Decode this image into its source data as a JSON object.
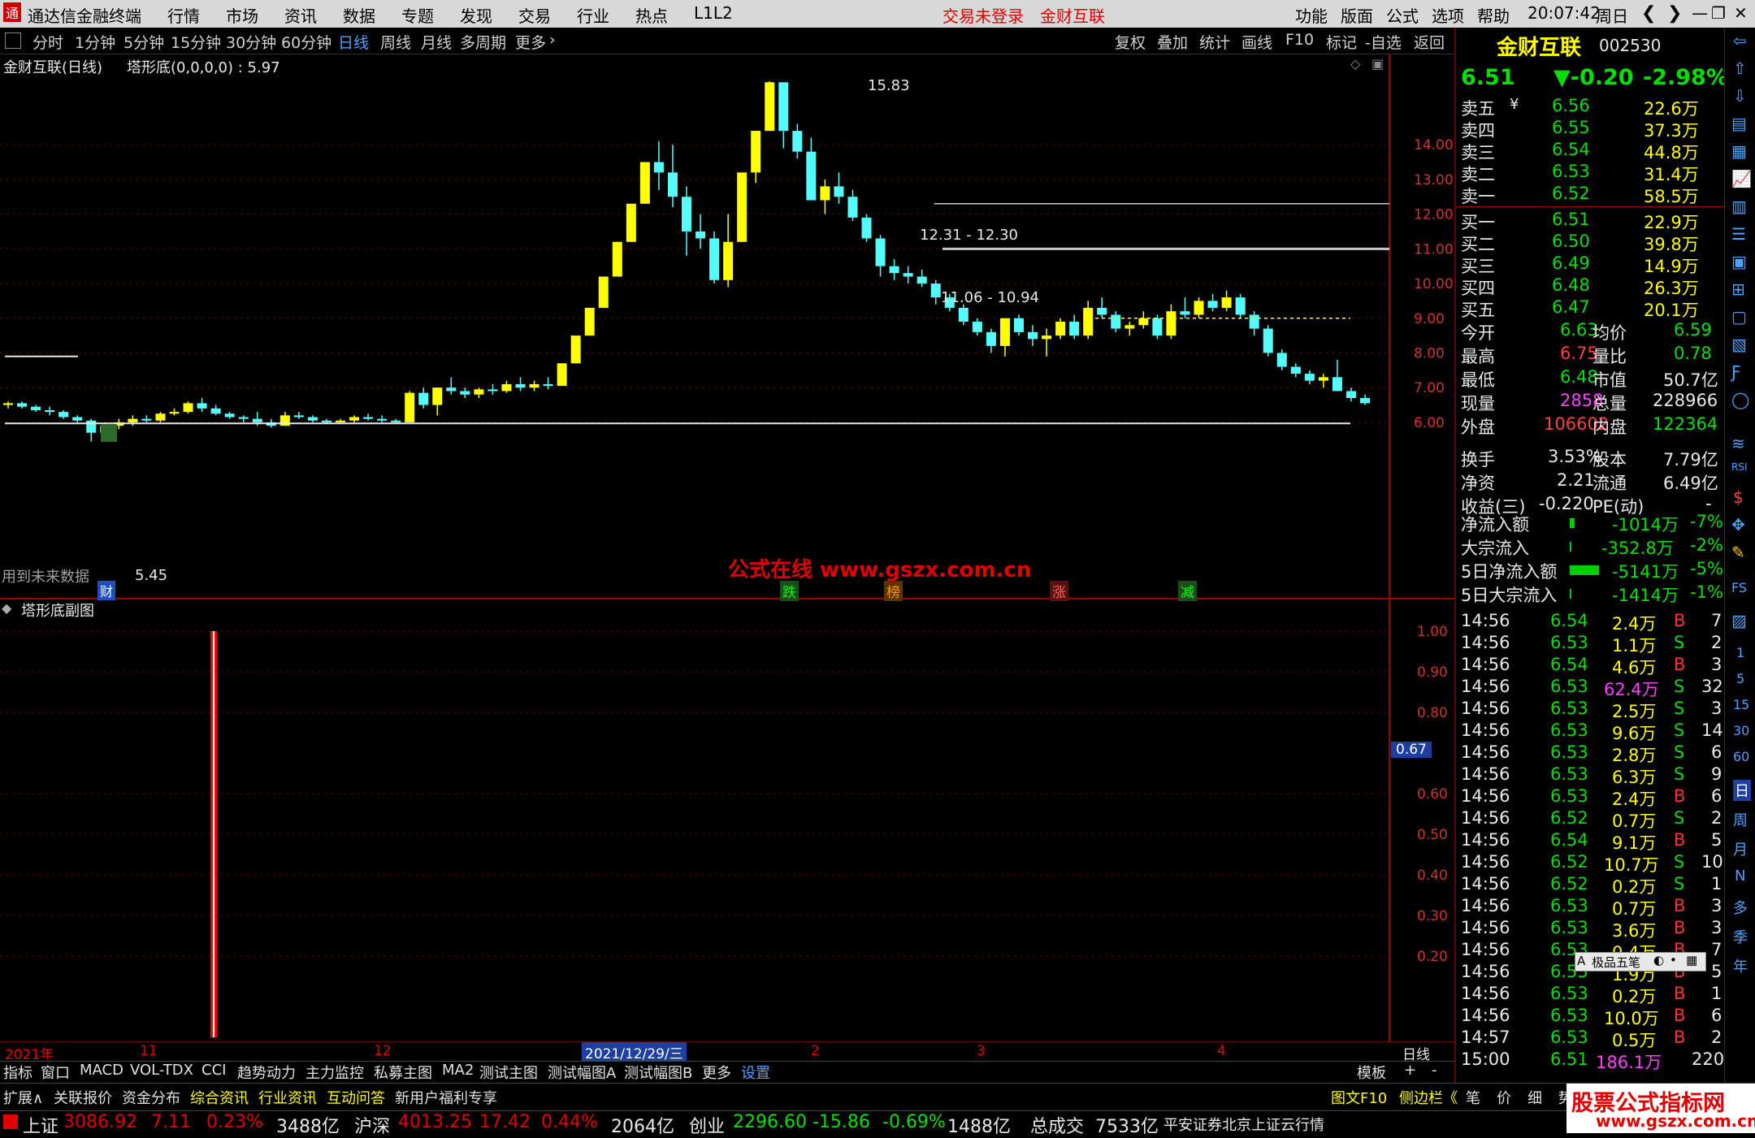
{
  "app": {
    "title": "通达信金融终端",
    "menu": [
      "行情",
      "市场",
      "资讯",
      "数据",
      "专题",
      "发现",
      "交易",
      "行业",
      "热点",
      "L1L2"
    ],
    "login_status": "交易未登录",
    "stock_label": "金财互联",
    "right_menu": [
      "功能",
      "版面",
      "公式",
      "选项",
      "帮助"
    ],
    "clock": "20:07:42",
    "weekday": "周日"
  },
  "periods": [
    "分时",
    "1分钟",
    "5分钟",
    "15分钟",
    "30分钟",
    "60分钟",
    "日线",
    "周线",
    "月线",
    "多周期",
    "更多"
  ],
  "active_period": "日线",
  "tools": [
    "复权",
    "叠加",
    "统计",
    "画线",
    "F10",
    "标记",
    "-自选",
    "返回"
  ],
  "chart": {
    "header_name": "金财互联(日线)",
    "indicator": "塔形底(0,0,0,0) : 5.97",
    "sub_header": "塔形底副图",
    "watermark": "公式在线  www.gszx.com.cn",
    "future_note": "用到未来数据",
    "cai_marker": "财",
    "markers": [
      "跌",
      "榜",
      "涨",
      "减"
    ],
    "annotations": {
      "high": "15.83",
      "low": "5.45",
      "level1": "12.31 - 12.30",
      "level2": "11.06 - 10.94"
    },
    "price_axis": [
      "14.00",
      "13.00",
      "12.00",
      "11.00",
      "10.00",
      "9.00",
      "8.00",
      "7.00",
      "6.00"
    ],
    "sub_axis": [
      "1.00",
      "0.90",
      "0.80",
      "0.60",
      "0.50",
      "0.40",
      "0.30",
      "0.20"
    ],
    "sub_current": "0.67",
    "date_labels": [
      "2021年",
      "11",
      "12",
      "2021/12/29/三",
      "2",
      "3",
      "4"
    ],
    "period_label": "日线",
    "colors": {
      "up": "#ffff00",
      "down": "#54fcfc",
      "grid": "#800000",
      "signal": "#ff0000"
    }
  },
  "chart_data": {
    "type": "candlestick",
    "title": "",
    "y_axis_range": [
      5.45,
      15.83
    ],
    "series": [
      {
        "values": [
          [
            6.5,
            6.6,
            6.4,
            6.55
          ],
          [
            6.55,
            6.6,
            6.4,
            6.45
          ],
          [
            6.45,
            6.5,
            6.3,
            6.35
          ],
          [
            6.35,
            6.45,
            6.2,
            6.3
          ],
          [
            6.3,
            6.35,
            6.1,
            6.15
          ],
          [
            6.15,
            6.2,
            6.0,
            6.05
          ],
          [
            6.05,
            6.1,
            5.45,
            5.7
          ],
          [
            5.7,
            6.0,
            5.6,
            5.9
          ],
          [
            5.9,
            6.1,
            5.8,
            6.0
          ],
          [
            6.0,
            6.2,
            5.9,
            6.1
          ],
          [
            6.1,
            6.2,
            6.0,
            6.05
          ],
          [
            6.05,
            6.3,
            6.0,
            6.25
          ],
          [
            6.25,
            6.4,
            6.2,
            6.3
          ],
          [
            6.3,
            6.6,
            6.25,
            6.55
          ],
          [
            6.55,
            6.7,
            6.3,
            6.4
          ],
          [
            6.4,
            6.5,
            6.2,
            6.25
          ],
          [
            6.25,
            6.3,
            6.1,
            6.15
          ],
          [
            6.15,
            6.2,
            6.0,
            6.1
          ],
          [
            6.1,
            6.3,
            5.9,
            6.0
          ],
          [
            6.0,
            6.1,
            5.85,
            5.9
          ],
          [
            5.9,
            6.3,
            5.9,
            6.2
          ],
          [
            6.2,
            6.3,
            6.1,
            6.15
          ],
          [
            6.15,
            6.2,
            6.0,
            6.05
          ],
          [
            6.05,
            6.1,
            5.95,
            6.0
          ],
          [
            6.0,
            6.1,
            5.95,
            6.05
          ],
          [
            6.05,
            6.2,
            6.0,
            6.15
          ],
          [
            6.15,
            6.25,
            6.05,
            6.1
          ],
          [
            6.1,
            6.2,
            6.0,
            6.05
          ],
          [
            6.05,
            6.1,
            5.95,
            6.0
          ],
          [
            6.0,
            6.9,
            6.0,
            6.85
          ],
          [
            6.85,
            7.0,
            6.4,
            6.5
          ],
          [
            6.5,
            7.0,
            6.2,
            7.0
          ],
          [
            7.0,
            7.3,
            6.8,
            6.9
          ],
          [
            6.9,
            7.0,
            6.7,
            6.8
          ],
          [
            6.8,
            7.0,
            6.7,
            6.95
          ],
          [
            6.95,
            7.1,
            6.8,
            6.9
          ],
          [
            6.9,
            7.2,
            6.85,
            7.1
          ],
          [
            7.1,
            7.3,
            6.9,
            7.0
          ],
          [
            7.0,
            7.2,
            6.9,
            7.1
          ],
          [
            7.1,
            7.3,
            6.95,
            7.05
          ],
          [
            7.05,
            7.7,
            7.05,
            7.7
          ],
          [
            7.7,
            8.5,
            7.7,
            8.5
          ],
          [
            8.5,
            9.3,
            8.5,
            9.3
          ],
          [
            9.3,
            10.2,
            9.3,
            10.2
          ],
          [
            10.2,
            11.2,
            10.2,
            11.2
          ],
          [
            11.2,
            12.3,
            11.2,
            12.3
          ],
          [
            12.3,
            13.5,
            12.3,
            13.5
          ],
          [
            13.5,
            14.1,
            12.7,
            13.2
          ],
          [
            13.2,
            14.0,
            12.2,
            12.5
          ],
          [
            12.5,
            12.8,
            10.8,
            11.5
          ],
          [
            11.5,
            12.0,
            11.0,
            11.3
          ],
          [
            11.3,
            11.5,
            10.0,
            10.1
          ],
          [
            10.1,
            12.0,
            9.9,
            11.2
          ],
          [
            11.2,
            13.2,
            11.2,
            13.2
          ],
          [
            13.2,
            14.4,
            12.9,
            14.4
          ],
          [
            14.4,
            15.83,
            14.4,
            15.8
          ],
          [
            15.8,
            15.0,
            13.9,
            14.4
          ],
          [
            14.4,
            14.6,
            13.6,
            13.8
          ],
          [
            13.8,
            14.2,
            12.4,
            12.4
          ],
          [
            12.4,
            13.0,
            12.0,
            12.8
          ],
          [
            12.8,
            13.2,
            12.3,
            12.5
          ],
          [
            12.5,
            12.7,
            11.8,
            11.9
          ],
          [
            11.9,
            12.0,
            11.2,
            11.3
          ],
          [
            11.3,
            11.4,
            10.2,
            10.5
          ],
          [
            10.5,
            10.7,
            10.1,
            10.3
          ],
          [
            10.3,
            10.5,
            10.0,
            10.2
          ],
          [
            10.2,
            10.4,
            9.9,
            10.0
          ],
          [
            10.0,
            10.1,
            9.4,
            9.6
          ],
          [
            9.6,
            9.7,
            9.2,
            9.3
          ],
          [
            9.3,
            9.4,
            8.8,
            8.9
          ],
          [
            8.9,
            9.0,
            8.5,
            8.6
          ],
          [
            8.6,
            8.7,
            8.0,
            8.2
          ],
          [
            8.2,
            9.0,
            7.9,
            9.0
          ],
          [
            9.0,
            9.1,
            8.5,
            8.6
          ],
          [
            8.6,
            8.8,
            8.2,
            8.4
          ],
          [
            8.4,
            8.7,
            7.9,
            8.5
          ],
          [
            8.5,
            9.0,
            8.4,
            8.9
          ],
          [
            8.9,
            9.1,
            8.4,
            8.5
          ],
          [
            8.5,
            9.5,
            8.4,
            9.3
          ],
          [
            9.3,
            9.6,
            9.0,
            9.1
          ],
          [
            9.1,
            9.2,
            8.6,
            8.7
          ],
          [
            8.7,
            8.9,
            8.5,
            8.8
          ],
          [
            8.8,
            9.2,
            8.7,
            9.0
          ],
          [
            9.0,
            9.1,
            8.4,
            8.5
          ],
          [
            8.5,
            9.4,
            8.4,
            9.2
          ],
          [
            9.2,
            9.6,
            9.0,
            9.1
          ],
          [
            9.1,
            9.6,
            9.0,
            9.5
          ],
          [
            9.5,
            9.7,
            9.2,
            9.3
          ],
          [
            9.3,
            9.8,
            9.2,
            9.6
          ],
          [
            9.6,
            9.7,
            9.0,
            9.1
          ],
          [
            9.1,
            9.2,
            8.5,
            8.7
          ],
          [
            8.7,
            8.8,
            7.9,
            8.0
          ],
          [
            8.0,
            8.1,
            7.5,
            7.6
          ],
          [
            7.6,
            7.7,
            7.3,
            7.4
          ],
          [
            7.4,
            7.5,
            7.1,
            7.2
          ],
          [
            7.2,
            7.4,
            7.0,
            7.3
          ],
          [
            7.3,
            7.8,
            7.2,
            6.9
          ],
          [
            6.9,
            7.0,
            6.6,
            6.7
          ],
          [
            6.7,
            6.8,
            6.5,
            6.55
          ]
        ]
      }
    ]
  },
  "quote": {
    "name": "金财互联",
    "code": "002530",
    "price": "6.51",
    "change": "▼-0.20",
    "pct": "-2.98%",
    "asks": [
      {
        "label": "卖五",
        "price": "6.56",
        "vol": "22.6万"
      },
      {
        "label": "卖四",
        "price": "6.55",
        "vol": "37.3万"
      },
      {
        "label": "卖三",
        "price": "6.54",
        "vol": "44.8万"
      },
      {
        "label": "卖二",
        "price": "6.53",
        "vol": "31.4万"
      },
      {
        "label": "卖一",
        "price": "6.52",
        "vol": "58.5万"
      }
    ],
    "bids": [
      {
        "label": "买一",
        "price": "6.51",
        "vol": "22.9万"
      },
      {
        "label": "买二",
        "price": "6.50",
        "vol": "39.8万"
      },
      {
        "label": "买三",
        "price": "6.49",
        "vol": "14.9万"
      },
      {
        "label": "买四",
        "price": "6.48",
        "vol": "26.3万"
      },
      {
        "label": "买五",
        "price": "6.47",
        "vol": "20.1万"
      }
    ],
    "ask_currency": "¥",
    "stats": [
      [
        "今开",
        "6.63",
        "均价",
        "6.59"
      ],
      [
        "最高",
        "6.75",
        "量比",
        "0.78"
      ],
      [
        "最低",
        "6.48",
        "市值",
        "50.7亿"
      ],
      [
        "现量",
        "2858",
        "总量",
        "228966"
      ],
      [
        "外盘",
        "106602",
        "内盘",
        "122364"
      ]
    ],
    "stats2": [
      [
        "换手",
        "3.53%",
        "股本",
        "7.79亿"
      ],
      [
        "净资",
        "2.21",
        "流通",
        "6.49亿"
      ],
      [
        "收益(三)",
        "-0.220",
        "PE(动)",
        "-"
      ]
    ],
    "flows": [
      [
        "净流入额",
        "-1014万",
        "-7%"
      ],
      [
        "大宗流入",
        "-352.8万",
        "-2%"
      ],
      [
        "5日净流入额",
        "-5141万",
        "-5%"
      ],
      [
        "5日大宗流入",
        "-1414万",
        "-1%"
      ]
    ],
    "ticks": [
      [
        "14:56",
        "6.54",
        "2.4万",
        "B",
        "7"
      ],
      [
        "14:56",
        "6.53",
        "1.1万",
        "S",
        "2"
      ],
      [
        "14:56",
        "6.54",
        "4.6万",
        "B",
        "3"
      ],
      [
        "14:56",
        "6.53",
        "62.4万",
        "S",
        "32"
      ],
      [
        "14:56",
        "6.53",
        "2.5万",
        "S",
        "3"
      ],
      [
        "14:56",
        "6.53",
        "9.6万",
        "S",
        "14"
      ],
      [
        "14:56",
        "6.53",
        "2.8万",
        "S",
        "6"
      ],
      [
        "14:56",
        "6.53",
        "6.3万",
        "S",
        "9"
      ],
      [
        "14:56",
        "6.53",
        "2.4万",
        "B",
        "6"
      ],
      [
        "14:56",
        "6.52",
        "0.7万",
        "S",
        "2"
      ],
      [
        "14:56",
        "6.54",
        "9.1万",
        "B",
        "5"
      ],
      [
        "14:56",
        "6.52",
        "10.7万",
        "S",
        "10"
      ],
      [
        "14:56",
        "6.52",
        "0.2万",
        "S",
        "1"
      ],
      [
        "14:56",
        "6.53",
        "0.7万",
        "B",
        "3"
      ],
      [
        "14:56",
        "6.53",
        "3.6万",
        "B",
        "3"
      ],
      [
        "14:56",
        "6.53",
        "0.4万",
        "B",
        "7"
      ],
      [
        "14:56",
        "6.53",
        "1.9万",
        "B",
        "5"
      ],
      [
        "14:56",
        "6.53",
        "0.2万",
        "B",
        "1"
      ],
      [
        "14:56",
        "6.53",
        "10.0万",
        "B",
        "6"
      ],
      [
        "14:57",
        "6.53",
        "0.5万",
        "B",
        "2"
      ],
      [
        "15:00",
        "6.51",
        "186.1万",
        "",
        "220"
      ]
    ],
    "ime": "极品五笔"
  },
  "bottom_tabs": [
    "指标",
    "窗口",
    "MACD",
    "VOL-TDX",
    "CCI",
    "趋势动力",
    "主力监控",
    "私募主图",
    "MA2",
    "测试主图",
    "测试幅图A",
    "测试幅图B",
    "更多",
    "设置"
  ],
  "bottom_right": [
    "模板",
    "+",
    "-"
  ],
  "ext_tabs": [
    "扩展∧",
    "关联报价",
    "资金分布",
    "综合资讯",
    "行业资讯",
    "互动问答",
    "新用户福利专享"
  ],
  "ext_right": [
    "图文F10",
    "侧边栏《",
    "笔",
    "价",
    "细",
    "势"
  ],
  "side_icons": [
    "日",
    "周",
    "月",
    "N",
    "多",
    "季",
    "年"
  ],
  "side_numbers": [
    "1",
    "5",
    "15",
    "30",
    "60"
  ],
  "status": {
    "sh_label": "上证",
    "sh": "3086.92",
    "sh_chg": "7.11",
    "sh_pct": "0.23%",
    "sh_amt": "3488亿",
    "sz_label": "沪深",
    "sz": "4013.25",
    "sz_chg": "17.42",
    "sz_pct": "0.44%",
    "sz_amt": "2064亿",
    "cy_label": "创业",
    "cy": "2296.60",
    "cy_chg": "-15.86",
    "cy_pct": "-0.69%",
    "cy_amt": "1488亿",
    "total_label": "总成交",
    "total": "7533亿",
    "broker": "平安证券北京上证云行情",
    "brand": "股票公式指标网",
    "brand_url": "www.gszx.com.cn"
  }
}
